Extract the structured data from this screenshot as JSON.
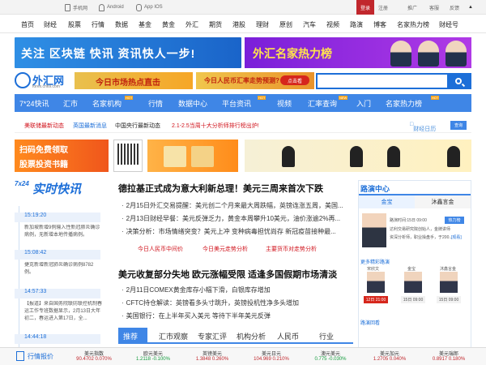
{
  "topbar": {
    "mobile": "手机网",
    "android": "Android",
    "ios": "App IOS",
    "login": "登录",
    "register": "注册",
    "service": "推广",
    "feedback": "客服",
    "help": "反馈"
  },
  "nav": [
    "首页",
    "财经",
    "股票",
    "行情",
    "数据",
    "基金",
    "黄金",
    "外汇",
    "期货",
    "港股",
    "理财",
    "原创",
    "汽车",
    "视频",
    "路演",
    "博客",
    "名家热力榜",
    "财经号"
  ],
  "banners": {
    "top_left": "关注 区块链 快讯  资讯快人一步!",
    "top_right": "外汇名家热力榜",
    "ad1": "今日市场热点直击",
    "ad2": "今日人民币汇率走势预测?",
    "ad2_btn": "点击看"
  },
  "logo": {
    "name": "外汇网",
    "sub": "forex.cnfol.com"
  },
  "search": {
    "placeholder": ""
  },
  "mainnav": [
    "7*24快讯",
    "汇市",
    "名家机构",
    "行情",
    "数据中心",
    "平台资讯",
    "视频",
    "汇率查询",
    "入门",
    "名家热力榜"
  ],
  "hot_label": "HOT",
  "new_label": "NEW",
  "ticker": {
    "l1": "美联储最新动态",
    "l2": "英国最新消息",
    "l3": "中国央行最新动态",
    "l4": "2.1-2.5当周十大分析师排行榜出炉!",
    "calendar": "财经日历",
    "query": "查询"
  },
  "mid_banners": {
    "b1a": "扫码免费领取",
    "b1b": "股票投资书籍"
  },
  "kuaixun": {
    "logo_num": "7x24",
    "title": "实时快讯",
    "items": [
      {
        "time": "15:19:20",
        "text": "新加坡新增9例输入性新冠肺炎确诊病例，无新增本地传播病例。"
      },
      {
        "time": "15:08:42",
        "text": "捷克新增新冠肺炎确诊病例8782例。"
      },
      {
        "time": "14:57:33",
        "text": "【报道】来自国务院联防联控机制春运工作专班数据显示，2月13日大年初二，春运进入第17日，全..."
      },
      {
        "time": "14:44:18",
        "text": ""
      }
    ]
  },
  "news": {
    "h1": "德拉基正式成为意大利新总理！美元三周来首次下跌",
    "list1": [
      "2月15日外汇交易提醒：美元创二个月来最大周跌幅，英镑连涨五周，美国...",
      "2月13日财经早餐：美元反弹乏力，黄金本周攀升10美元，油价涨逾2%再...",
      "决策分析：市场情绪突变？美元上冲 变种病毒担忧尚存 新冠疫苗接种最..."
    ],
    "red1": "今日人民币中间价",
    "red2": "今日美元走势分析",
    "red3": "主要货币对走势分析",
    "h2": "美元收复部分失地 欧元涨幅受限 适逢多国假期市场清淡",
    "list2": [
      "2月11日COMEX黄金库存小幅下滑，白银库存增加",
      "CFTC持仓解读：英镑看多头寸跳升，英镑投机性净多头增加",
      "美国银行：在上半年买入美元 等待下半年美元反弹"
    ],
    "tabs": [
      "推荐",
      "汇市观察",
      "专家汇评",
      "机构分析",
      "人民币",
      "行业"
    ]
  },
  "roadshow": {
    "title": "路演中心",
    "tab1": "金宝",
    "tab2": "沐鑫言金",
    "line1": "路演时间:15日 09:00",
    "hot": "热力榜",
    "line2": "达利交易研究院创始人，金牌讲师",
    "line3": "资深分析师，职业操盘手，于200...",
    "more": "[观看]",
    "section": "更多精彩路演",
    "names": [
      "宋欣文",
      "金宝",
      "沐鑫言金"
    ],
    "dates": [
      "12日 21:00",
      "15日 09:00",
      "15日 09:00"
    ],
    "history": "路演回看"
  },
  "quotes": {
    "label": "行情报价",
    "items": [
      {
        "name": "美元指数",
        "value": "90.4702",
        "change": "0.070%",
        "down": false
      },
      {
        "name": "欧元美元",
        "value": "1.2118",
        "change": "-0.100%",
        "down": true
      },
      {
        "name": "英镑美元",
        "value": "1.3848",
        "change": "0.260%",
        "down": false
      },
      {
        "name": "美元日元",
        "value": "104.969",
        "change": "0.210%",
        "down": false
      },
      {
        "name": "澳元美元",
        "value": "0.775",
        "change": "-0.030%",
        "down": true
      },
      {
        "name": "美元加元",
        "value": "1.2705",
        "change": "0.040%",
        "down": false
      },
      {
        "name": "美元瑞郎",
        "value": "0.8917",
        "change": "0.180%",
        "down": false
      }
    ]
  },
  "colors": {
    "brand_blue": "#3f86e6",
    "red": "#c1272d",
    "green": "#129b3c"
  }
}
